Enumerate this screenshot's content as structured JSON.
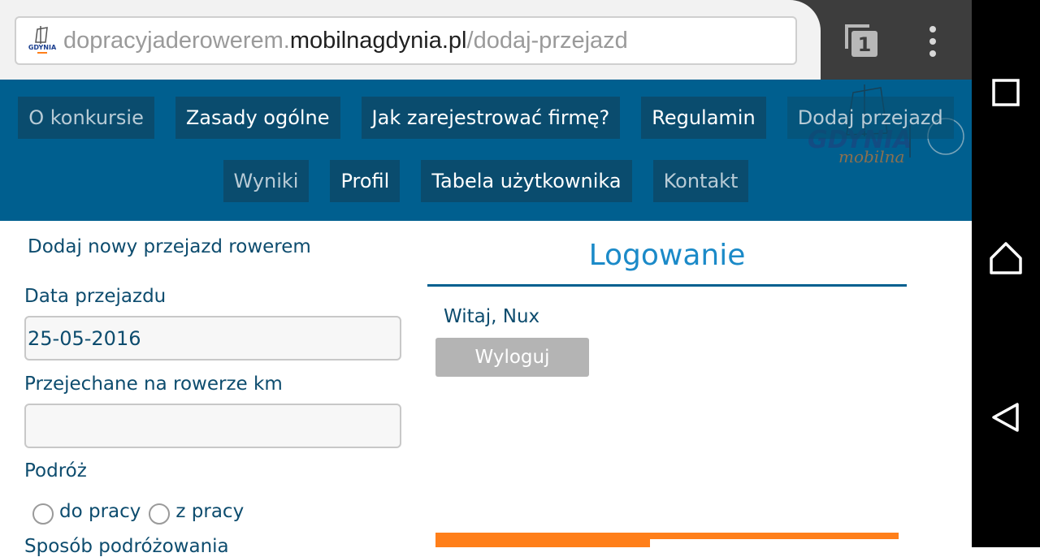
{
  "browser": {
    "url_prefix": "dopracyjaderowerem.",
    "url_host": "mobilnagdynia.pl",
    "url_path": "/dodaj-przejazd",
    "tab_count": "1",
    "favicon_text": "GDYNIA"
  },
  "header": {
    "logo_text": "GDYNIA",
    "logo_subtext": "mobilna",
    "nav_row1": [
      {
        "label": "O konkursie"
      },
      {
        "label": "Zasady ogólne"
      },
      {
        "label": "Jak zarejestrować firmę?"
      },
      {
        "label": "Regulamin"
      },
      {
        "label": "Dodaj przejazd"
      }
    ],
    "nav_row2": [
      {
        "label": "Wyniki"
      },
      {
        "label": "Profil"
      },
      {
        "label": "Tabela użytkownika"
      },
      {
        "label": "Kontakt"
      }
    ]
  },
  "form": {
    "title": "Dodaj nowy przejazd rowerem",
    "date_label": "Data przejazdu",
    "date_value": "25-05-2016",
    "km_label": "Przejechane na rowerze km",
    "km_value": "",
    "trip_label": "Podróż",
    "trip_options": [
      "do pracy",
      "z pracy"
    ],
    "next_label_partial": "Sposób podróżowania"
  },
  "login": {
    "title": "Logowanie",
    "greeting": "Witaj, Nux",
    "logout_label": "Wyloguj"
  },
  "colors": {
    "header_bg": "#005f8f",
    "nav_item_bg": "#0a4c6e",
    "text_dark_blue": "#0d4c6e",
    "login_title": "#1b8ac8",
    "logout_bg": "#b4b4b4",
    "banner_orange": "#ff7f1a"
  },
  "icons": {
    "tab_switcher": "tab-switcher-icon",
    "overflow_menu": "more-vert-icon",
    "recents": "recents-square-icon",
    "home": "home-icon",
    "back": "back-triangle-icon"
  }
}
